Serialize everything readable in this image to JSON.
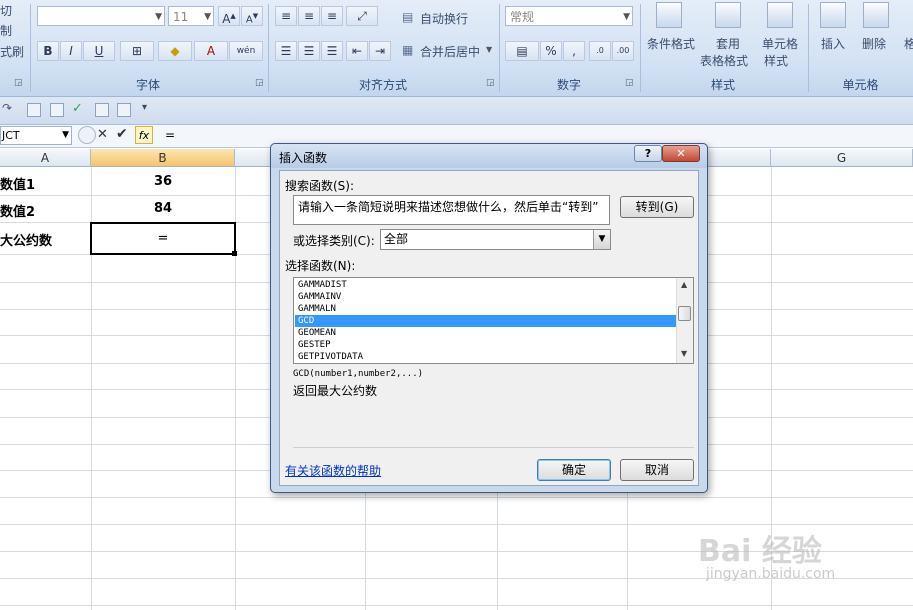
{
  "ribbon": {
    "clipboard": {
      "cut": "切",
      "copy": "制",
      "format_painter": "式刷"
    },
    "font": {
      "name": "",
      "size": "11",
      "group_label": "字体",
      "grow": "A",
      "shrink": "A",
      "bold": "B",
      "italic": "I",
      "underline": "U",
      "font_color_letter": "A",
      "phonetic": "wén"
    },
    "alignment": {
      "wrap_text": "自动换行",
      "merge_center": "合并后居中",
      "group_label": "对齐方式"
    },
    "number": {
      "format": "常规",
      "percent": "%",
      "comma": ",",
      "group_label": "数字"
    },
    "styles": {
      "conditional": "条件格式",
      "table_format_line1": "套用",
      "table_format_line2": "表格格式",
      "cell_styles_line1": "单元格",
      "cell_styles_line2": "样式",
      "group_label": "样式"
    },
    "cells": {
      "insert": "插入",
      "delete": "删除",
      "format": "格",
      "group_label": "单元格"
    }
  },
  "formula_bar": {
    "name_box": "JCT",
    "formula": "="
  },
  "grid": {
    "columns": [
      "A",
      "B",
      "G"
    ],
    "rows": [
      {
        "a": "数值1",
        "b": "36"
      },
      {
        "a": "数值2",
        "b": "84"
      },
      {
        "a": "大公约数",
        "b": "="
      }
    ]
  },
  "dialog": {
    "title": "插入函数",
    "help_button": "?",
    "close_button": "✕",
    "search_label": "搜索函数(S):",
    "search_value": "请输入一条简短说明来描述您想做什么，然后单击“转到”",
    "go_button": "转到(G)",
    "category_label": "或选择类别(C):",
    "category_value": "全部",
    "function_label": "选择函数(N):",
    "functions": [
      "GAMMADIST",
      "GAMMAINV",
      "GAMMALN",
      "GCD",
      "GEOMEAN",
      "GESTEP",
      "GETPIVOTDATA"
    ],
    "selected_index": 3,
    "signature": "GCD(number1,number2,...)",
    "description": "返回最大公约数",
    "help_link": "有关该函数的帮助",
    "ok_button": "确定",
    "cancel_button": "取消"
  },
  "watermark": {
    "brand": "Bai 经验",
    "url": "jingyan.baidu.com"
  }
}
